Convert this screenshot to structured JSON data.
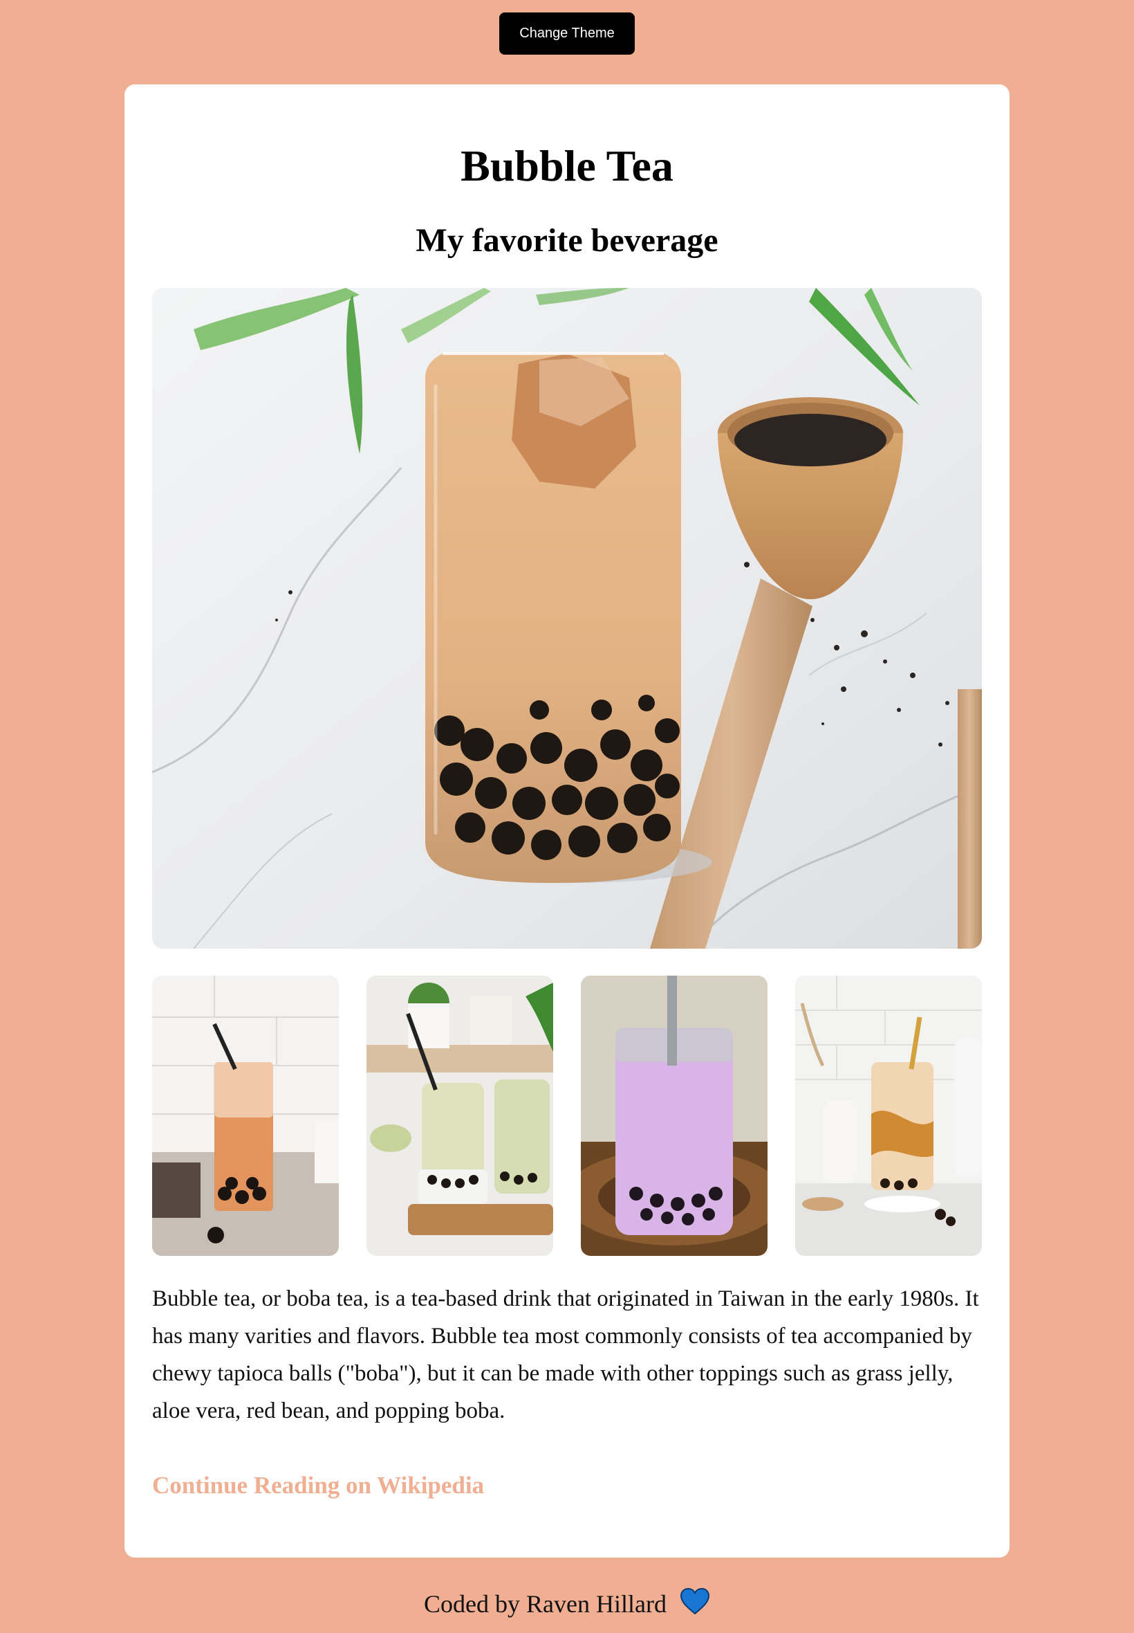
{
  "header": {
    "theme_button_label": "Change Theme"
  },
  "article": {
    "title": "Bubble Tea",
    "subtitle": "My favorite beverage",
    "description": "Bubble tea, or boba tea, is a tea-based drink that originated in Taiwan in the early 1980s. It has many varities and flavors. Bubble tea most commonly consists of tea accompanied by chewy tapioca balls (\"boba\"), but it can be made with other toppings such as grass jelly, aloe vera, red bean, and popping boba.",
    "link_label": "Continue Reading on Wikipedia"
  },
  "footer": {
    "credit": "Coded by Raven Hillard",
    "heart_icon": "blue-heart-icon"
  },
  "colors": {
    "background": "#f0ae92",
    "card": "#ffffff",
    "accent": "#f0ae92",
    "button": "#000000",
    "heart": "#1976d2"
  }
}
